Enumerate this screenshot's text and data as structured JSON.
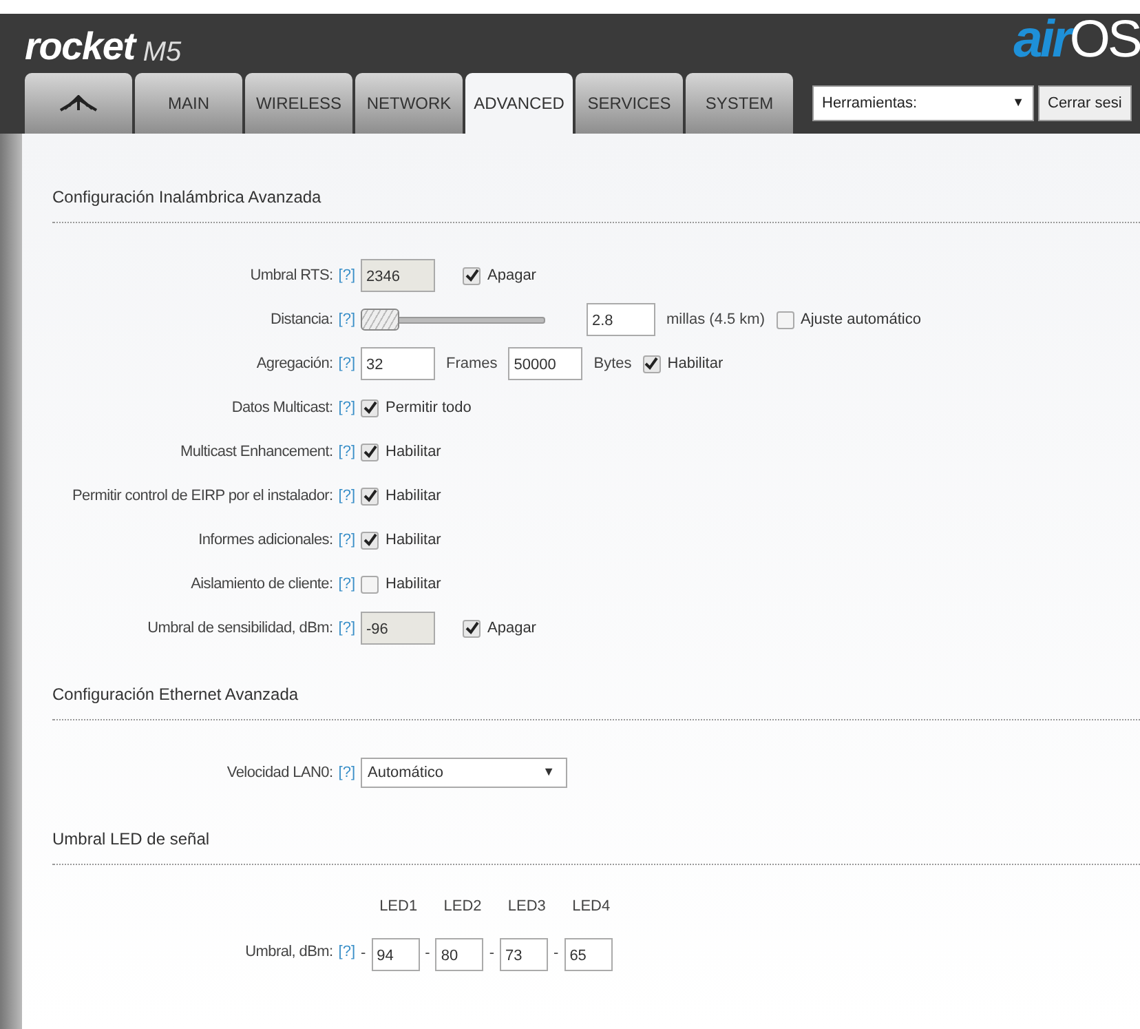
{
  "header": {
    "product": "rocket",
    "model": "M5",
    "brand_prefix": "air",
    "brand_suffix": "OS"
  },
  "tabs": [
    {
      "kind": "icon",
      "selected": false
    },
    {
      "kind": "text",
      "label": "MAIN",
      "selected": false
    },
    {
      "kind": "text",
      "label": "WIRELESS",
      "selected": false
    },
    {
      "kind": "text",
      "label": "NETWORK",
      "selected": false
    },
    {
      "kind": "text",
      "label": "ADVANCED",
      "selected": true
    },
    {
      "kind": "text",
      "label": "SERVICES",
      "selected": false
    },
    {
      "kind": "text",
      "label": "SYSTEM",
      "selected": false
    }
  ],
  "tools": {
    "value": "Herramientas:",
    "arrow": "▼"
  },
  "logout_button": "Cerrar sesi",
  "sections": [
    {
      "title": "Configuración Inalámbrica Avanzada",
      "rows": [
        {
          "kind": "input_check",
          "label": "Umbral RTS:",
          "help": "[?]",
          "value": "2346",
          "disabled": true,
          "check": {
            "label": "Apagar",
            "checked": true
          }
        },
        {
          "kind": "slider",
          "label": "Distancia:",
          "help": "[?]",
          "level": 0.0,
          "value": "2.8",
          "unit": "millas (4.5 km)",
          "check": {
            "label": "Ajuste automático",
            "checked": false
          }
        },
        {
          "kind": "aggregation",
          "label": "Agregación:",
          "help": "[?]",
          "frames": "32",
          "frames_unit": "Frames",
          "bytes": "50000",
          "bytes_unit": "Bytes",
          "check": {
            "label": "Habilitar",
            "checked": true
          }
        },
        {
          "kind": "check",
          "label": "Datos Multicast:",
          "help": "[?]",
          "check": {
            "label": "Permitir todo",
            "checked": true
          }
        },
        {
          "kind": "check",
          "label": "Multicast Enhancement:",
          "help": "[?]",
          "check": {
            "label": "Habilitar",
            "checked": true
          }
        },
        {
          "kind": "check",
          "label": "Permitir control de EIRP por el instalador:",
          "help": "[?]",
          "check": {
            "label": "Habilitar",
            "checked": true
          }
        },
        {
          "kind": "check",
          "label": "Informes adicionales:",
          "help": "[?]",
          "check": {
            "label": "Habilitar",
            "checked": true
          }
        },
        {
          "kind": "check",
          "label": "Aislamiento de cliente:",
          "help": "[?]",
          "check": {
            "label": "Habilitar",
            "checked": false
          }
        },
        {
          "kind": "input_check",
          "label": "Umbral de sensibilidad, dBm:",
          "help": "[?]",
          "value": "-96",
          "disabled": true,
          "check": {
            "label": "Apagar",
            "checked": true
          }
        }
      ]
    },
    {
      "title": "Configuración Ethernet Avanzada",
      "rows": [
        {
          "kind": "select",
          "label": "Velocidad LAN0:",
          "help": "[?]",
          "value": "Automático",
          "arrow": "▼"
        }
      ]
    },
    {
      "title": "Umbral LED de señal",
      "rows": [
        {
          "kind": "leds",
          "label": "Umbral, dBm:",
          "help": "[?]",
          "leds": [
            {
              "name": "LED1",
              "sign": "-",
              "value": "94"
            },
            {
              "name": "LED2",
              "sign": "-",
              "value": "80"
            },
            {
              "name": "LED3",
              "sign": "-",
              "value": "73"
            },
            {
              "name": "LED4",
              "sign": "-",
              "value": "65"
            }
          ]
        }
      ]
    }
  ]
}
